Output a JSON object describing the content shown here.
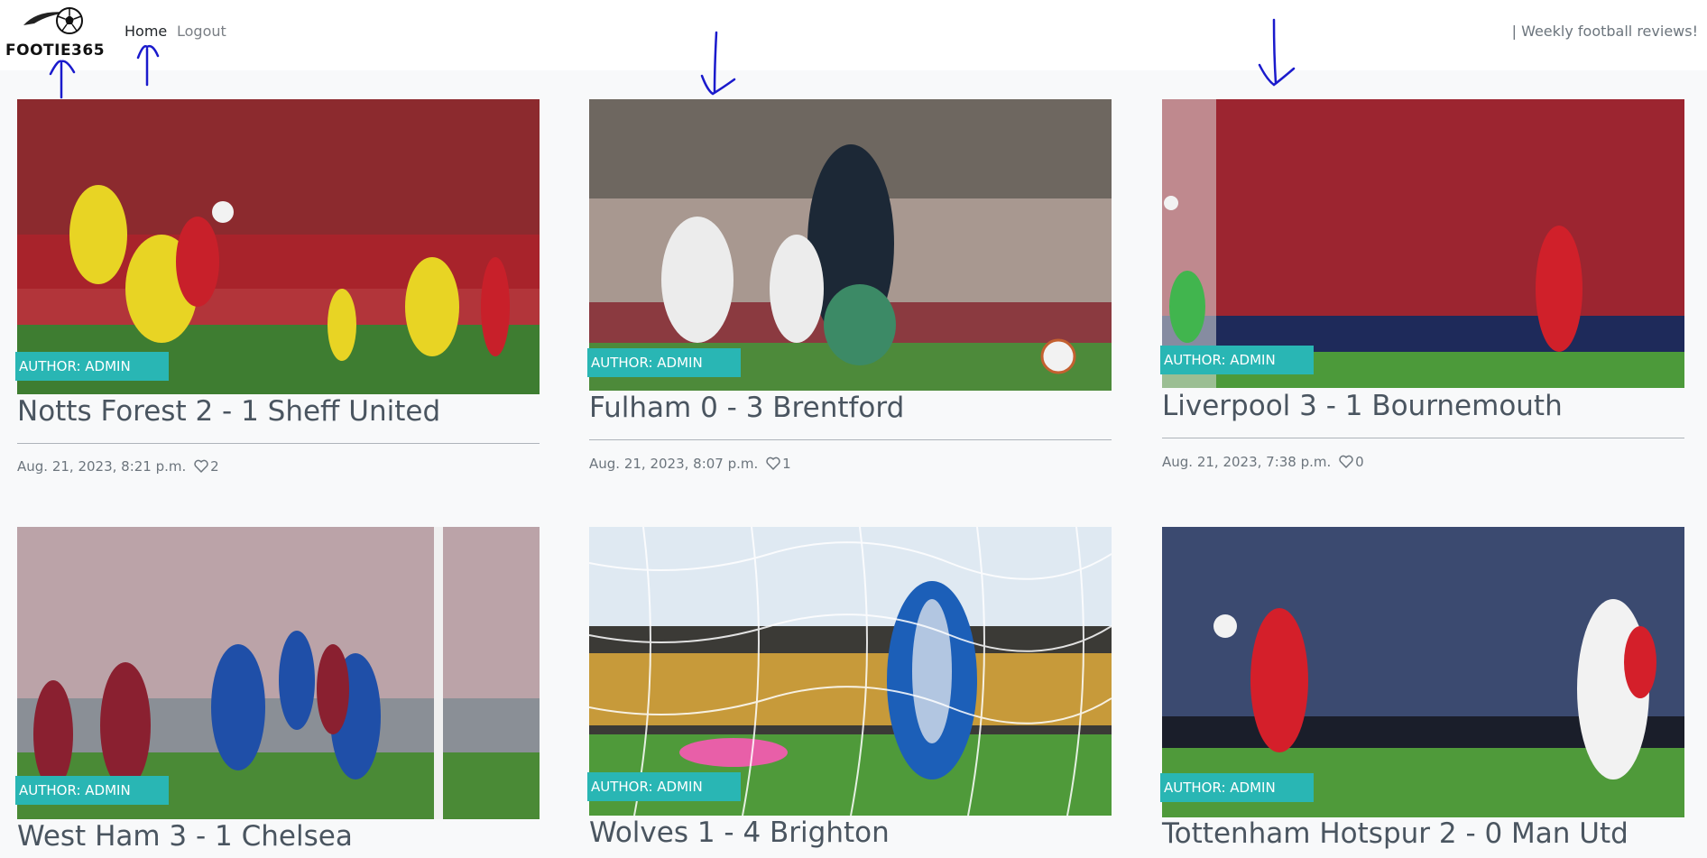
{
  "navbar": {
    "brand": "FOOTIE365",
    "links": [
      {
        "label": "Home"
      },
      {
        "label": "Logout"
      }
    ],
    "tagline": "| Weekly football reviews!"
  },
  "posts": [
    {
      "author": "AUTHOR: ADMIN",
      "title": "Notts Forest 2 - 1 Sheff United",
      "date": "Aug. 21, 2023, 8:21 p.m.",
      "likes": "2"
    },
    {
      "author": "AUTHOR: ADMIN",
      "title": "Fulham 0 - 3 Brentford",
      "date": "Aug. 21, 2023, 8:07 p.m.",
      "likes": "1"
    },
    {
      "author": "AUTHOR: ADMIN",
      "title": "Liverpool 3 - 1 Bournemouth",
      "date": "Aug. 21, 2023, 7:38 p.m.",
      "likes": "0"
    },
    {
      "author": "AUTHOR: ADMIN",
      "title": "West Ham 3 - 1 Chelsea"
    },
    {
      "author": "AUTHOR: ADMIN",
      "title": "Wolves 1 - 4 Brighton"
    },
    {
      "author": "AUTHOR: ADMIN",
      "title": "Tottenham Hotspur 2 - 0 Man Utd"
    }
  ],
  "colors": {
    "badge": "#29b6b4",
    "annotation_ink": "#1a1acc",
    "page_bg": "#f8f9fa"
  },
  "icons": {
    "logo": "football-logo-icon",
    "like": "heart-icon",
    "annotations": "hand-drawn-arrow-icon"
  }
}
